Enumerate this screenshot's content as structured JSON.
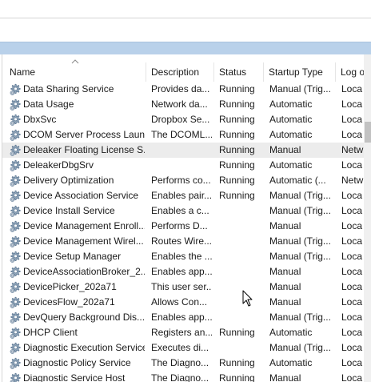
{
  "columns": {
    "name": "Name",
    "description": "Description",
    "status": "Status",
    "startup_type": "Startup Type",
    "log_on_as": "Log o"
  },
  "icon": "gear-icon",
  "rows": [
    {
      "name": "Data Sharing Service",
      "description": "Provides da...",
      "status": "Running",
      "startup": "Manual (Trig...",
      "log": "Loca"
    },
    {
      "name": "Data Usage",
      "description": "Network da...",
      "status": "Running",
      "startup": "Automatic",
      "log": "Loca"
    },
    {
      "name": "DbxSvc",
      "description": "Dropbox Se...",
      "status": "Running",
      "startup": "Automatic",
      "log": "Loca"
    },
    {
      "name": "DCOM Server Process Laun...",
      "description": "The DCOML...",
      "status": "Running",
      "startup": "Automatic",
      "log": "Loca"
    },
    {
      "name": "Deleaker Floating License S...",
      "description": "",
      "status": "Running",
      "startup": "Manual",
      "log": "Netw"
    },
    {
      "name": "DeleakerDbgSrv",
      "description": "",
      "status": "Running",
      "startup": "Automatic",
      "log": "Loca"
    },
    {
      "name": "Delivery Optimization",
      "description": "Performs co...",
      "status": "Running",
      "startup": "Automatic (...",
      "log": "Netw"
    },
    {
      "name": "Device Association Service",
      "description": "Enables pair...",
      "status": "Running",
      "startup": "Manual (Trig...",
      "log": "Loca"
    },
    {
      "name": "Device Install Service",
      "description": "Enables a c...",
      "status": "",
      "startup": "Manual (Trig...",
      "log": "Loca"
    },
    {
      "name": "Device Management Enroll...",
      "description": "Performs D...",
      "status": "",
      "startup": "Manual",
      "log": "Loca"
    },
    {
      "name": "Device Management Wirel...",
      "description": "Routes Wire...",
      "status": "",
      "startup": "Manual (Trig...",
      "log": "Loca"
    },
    {
      "name": "Device Setup Manager",
      "description": "Enables the ...",
      "status": "",
      "startup": "Manual (Trig...",
      "log": "Loca"
    },
    {
      "name": "DeviceAssociationBroker_2...",
      "description": "Enables app...",
      "status": "",
      "startup": "Manual",
      "log": "Loca"
    },
    {
      "name": "DevicePicker_202a71",
      "description": "This user ser...",
      "status": "",
      "startup": "Manual",
      "log": "Loca"
    },
    {
      "name": "DevicesFlow_202a71",
      "description": "Allows Con...",
      "status": "",
      "startup": "Manual",
      "log": "Loca"
    },
    {
      "name": "DevQuery Background Dis...",
      "description": "Enables app...",
      "status": "",
      "startup": "Manual (Trig...",
      "log": "Loca"
    },
    {
      "name": "DHCP Client",
      "description": "Registers an...",
      "status": "Running",
      "startup": "Automatic",
      "log": "Loca"
    },
    {
      "name": "Diagnostic Execution Service",
      "description": "Executes di...",
      "status": "",
      "startup": "Manual (Trig...",
      "log": "Loca"
    },
    {
      "name": "Diagnostic Policy Service",
      "description": "The Diagno...",
      "status": "Running",
      "startup": "Automatic",
      "log": "Loca"
    },
    {
      "name": "Diagnostic Service Host",
      "description": "The Diagno...",
      "status": "Running",
      "startup": "Manual",
      "log": "Loca"
    }
  ]
}
